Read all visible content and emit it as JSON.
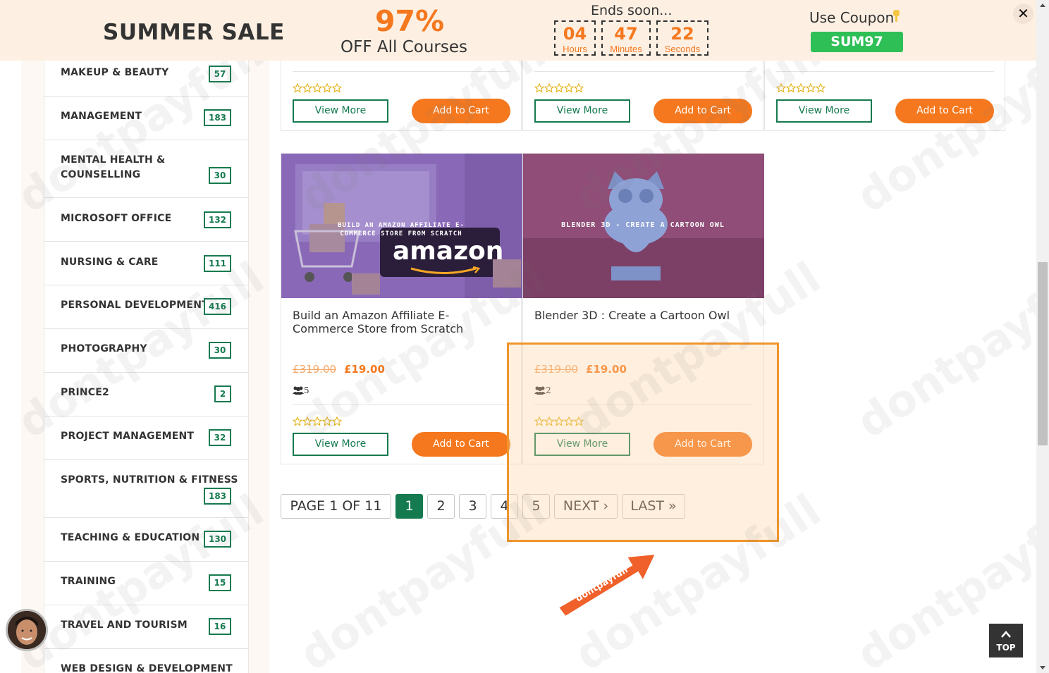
{
  "banner": {
    "title": "SUMMER SALE",
    "discount": "97%",
    "discount_sub": "OFF All Courses",
    "ends_label": "Ends soon...",
    "countdown": [
      {
        "value": "04",
        "unit": "Hours"
      },
      {
        "value": "47",
        "unit": "Minutes"
      },
      {
        "value": "22",
        "unit": "Seconds"
      }
    ],
    "use_coupon": "Use Coupon",
    "coupon_code": "SUM97",
    "close": "✕"
  },
  "sidebar": {
    "categories": [
      {
        "label": "MAKEUP & BEAUTY",
        "count": "57"
      },
      {
        "label": "MANAGEMENT",
        "count": "183"
      },
      {
        "label": "MENTAL HEALTH &",
        "label2": "COUNSELLING",
        "count": "30"
      },
      {
        "label": "MICROSOFT OFFICE",
        "count": "132"
      },
      {
        "label": "NURSING & CARE",
        "count": "111"
      },
      {
        "label": "PERSONAL DEVELOPMENT",
        "count": "416"
      },
      {
        "label": "PHOTOGRAPHY",
        "count": "30"
      },
      {
        "label": "PRINCE2",
        "count": "2"
      },
      {
        "label": "PROJECT MANAGEMENT",
        "count": "32"
      },
      {
        "label": "SPORTS, NUTRITION & FITNESS",
        "count": "183"
      },
      {
        "label": "TEACHING & EDUCATION",
        "count": "130"
      },
      {
        "label": "TRAINING",
        "count": "15"
      },
      {
        "label": "TRAVEL AND TOURISM",
        "count": "16"
      },
      {
        "label": "WEB DESIGN & DEVELOPMENT",
        "count": ""
      }
    ]
  },
  "courses": {
    "view_more": "View More",
    "add_to_cart": "Add to Cart",
    "items": [
      {
        "title": "Build an Amazon Affiliate E-Commerce Store from Scratch",
        "image_caption": "BUILD AN AMAZON AFFILIATE E-COMMERCE STORE FROM SCRATCH",
        "image_logo": "amazon",
        "old_price": "£319.00",
        "price": "£19.00",
        "students": "5"
      },
      {
        "title": "Blender 3D : Create a Cartoon Owl",
        "image_caption": "BLENDER 3D - CREATE A CARTOON OWL",
        "old_price": "£319.00",
        "price": "£19.00",
        "students": "2"
      }
    ]
  },
  "pagination": {
    "summary": "PAGE 1 OF 11",
    "pages": [
      "1",
      "2",
      "3",
      "4",
      "5"
    ],
    "active": "1",
    "next": "NEXT ›",
    "last": "LAST »"
  },
  "watermark": "dontpayfull",
  "arrow_label": "dontpayfull",
  "top_button": "TOP",
  "colors": {
    "accent": "#f5781e",
    "green": "#157a4f",
    "coupon_green": "#2fbf57",
    "banner_bg": "#fdf0e3",
    "highlight": "#f0952b"
  }
}
